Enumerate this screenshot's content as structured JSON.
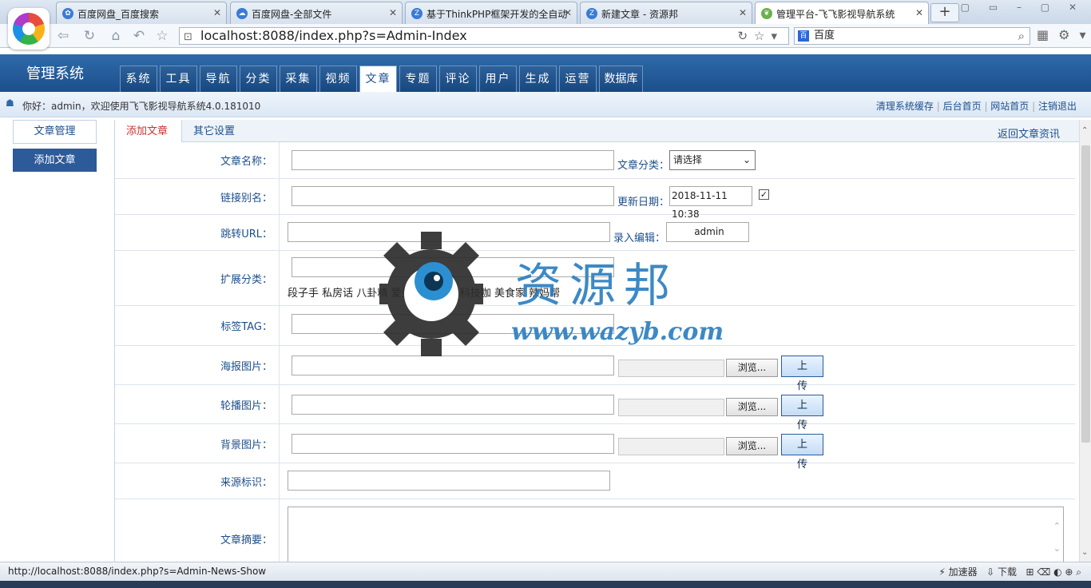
{
  "browser": {
    "tabs": [
      {
        "title": "百度网盘_百度搜索",
        "icon": "baidu-paw-icon"
      },
      {
        "title": "百度网盘-全部文件",
        "icon": "cloud-icon"
      },
      {
        "title": "基于ThinkPHP框架开发的全自动",
        "icon": "site-icon"
      },
      {
        "title": "新建文章 - 资源邦",
        "icon": "site-icon"
      },
      {
        "title": "管理平台-飞飞影视导航系统",
        "icon": "leaf-icon"
      }
    ],
    "url": "localhost:8088/index.php?s=Admin-Index",
    "search_engine": "百度",
    "status_url": "http://localhost:8088/index.php?s=Admin-News-Show",
    "status_right": [
      "加速器",
      "下载"
    ]
  },
  "app": {
    "name": "管理系统",
    "menu": [
      "系统",
      "工具",
      "导航",
      "分类",
      "采集",
      "视频",
      "文章",
      "专题",
      "评论",
      "用户",
      "生成",
      "运营",
      "数据库"
    ],
    "active_menu": "文章",
    "welcome": "你好：admin，欢迎使用飞飞影视导航系统4.0.181010",
    "top_links": [
      "清理系统缓存",
      "后台首页",
      "网站首页",
      "注销退出"
    ]
  },
  "sidebar": {
    "items": [
      {
        "label": "文章管理"
      },
      {
        "label": "添加文章"
      }
    ],
    "active": "添加文章"
  },
  "content": {
    "tabs": [
      {
        "label": "添加文章"
      },
      {
        "label": "其它设置"
      }
    ],
    "back_link": "返回文章资讯",
    "fields": {
      "title": {
        "label": "文章名称：",
        "value": ""
      },
      "category": {
        "label": "文章分类：",
        "selected": "请选择"
      },
      "alias": {
        "label": "链接别名：",
        "value": ""
      },
      "update_date": {
        "label": "更新日期：",
        "value": "2018-11-11 10:38",
        "checked": true
      },
      "jump_url": {
        "label": "跳转URL：",
        "value": ""
      },
      "editor": {
        "label": "录入编辑：",
        "value": "admin"
      },
      "ext_category": {
        "label": "扩展分类：",
        "value": "",
        "options": [
          "段子手",
          "私房话",
          "八卦精",
          "爱生活",
          "汽车迷",
          "科技咖",
          "美食家",
          "辣妈帮"
        ]
      },
      "tag": {
        "label": "标签TAG：",
        "value": ""
      },
      "poster": {
        "label": "海报图片：",
        "browse": "浏览...",
        "upload": "上 传"
      },
      "carousel": {
        "label": "轮播图片：",
        "browse": "浏览...",
        "upload": "上 传"
      },
      "background": {
        "label": "背景图片：",
        "browse": "浏览...",
        "upload": "上 传"
      },
      "source": {
        "label": "来源标识：",
        "value": ""
      },
      "summary": {
        "label": "文章摘要：",
        "value": ""
      }
    }
  },
  "watermark": {
    "name": "资源邦",
    "site": "www.wazyb.com"
  }
}
